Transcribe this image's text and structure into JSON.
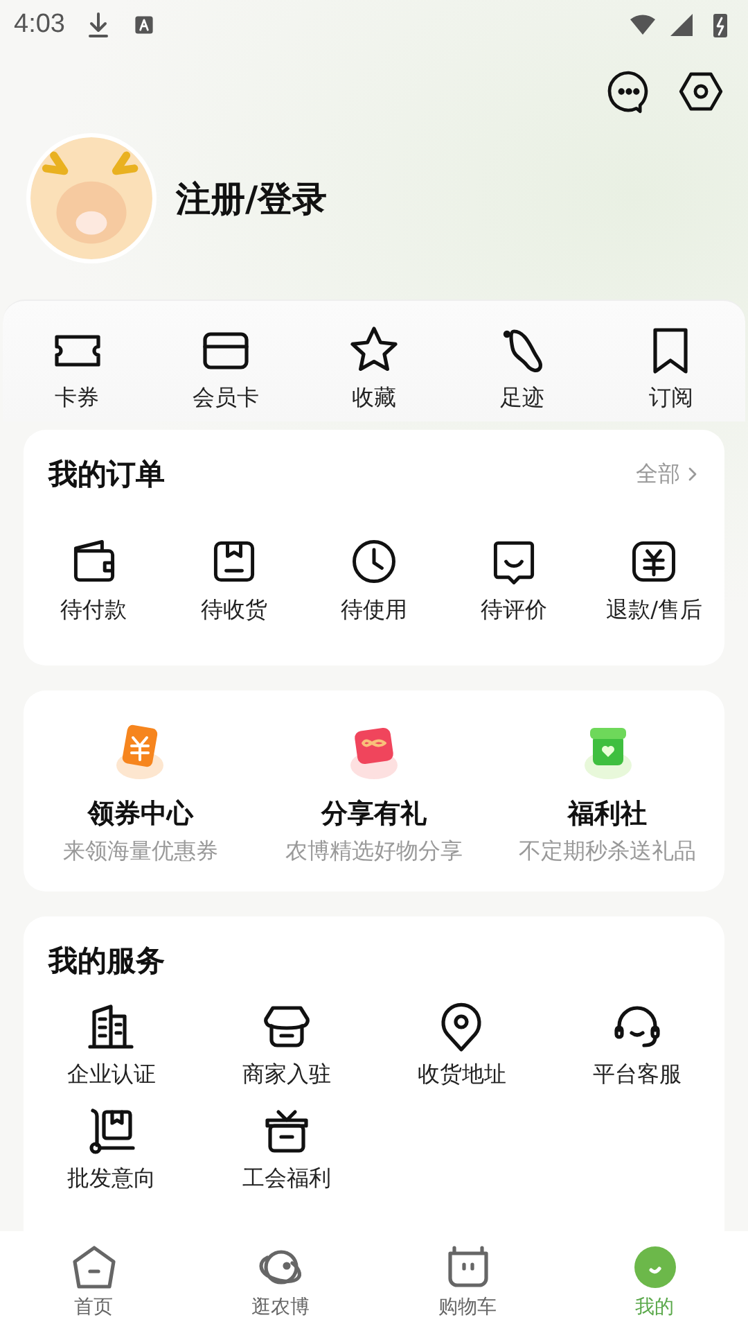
{
  "status_bar": {
    "time": "4:03"
  },
  "profile": {
    "login_label": "注册/登录"
  },
  "quick_links": [
    {
      "label": "卡券"
    },
    {
      "label": "会员卡"
    },
    {
      "label": "收藏"
    },
    {
      "label": "足迹"
    },
    {
      "label": "订阅"
    }
  ],
  "orders": {
    "title": "我的订单",
    "all_link": "全部",
    "items": [
      {
        "label": "待付款"
      },
      {
        "label": "待收货"
      },
      {
        "label": "待使用"
      },
      {
        "label": "待评价"
      },
      {
        "label": "退款/售后"
      }
    ]
  },
  "promos": [
    {
      "title": "领券中心",
      "subtitle": "来领海量优惠券"
    },
    {
      "title": "分享有礼",
      "subtitle": "农博精选好物分享"
    },
    {
      "title": "福利社",
      "subtitle": "不定期秒杀送礼品"
    }
  ],
  "services": {
    "title": "我的服务",
    "items": [
      {
        "label": "企业认证"
      },
      {
        "label": "商家入驻"
      },
      {
        "label": "收货地址"
      },
      {
        "label": "平台客服"
      },
      {
        "label": "批发意向"
      },
      {
        "label": "工会福利"
      }
    ]
  },
  "tab_bar": [
    {
      "label": "首页",
      "selected": false
    },
    {
      "label": "逛农博",
      "selected": false
    },
    {
      "label": "购物车",
      "selected": false
    },
    {
      "label": "我的",
      "selected": true
    }
  ]
}
